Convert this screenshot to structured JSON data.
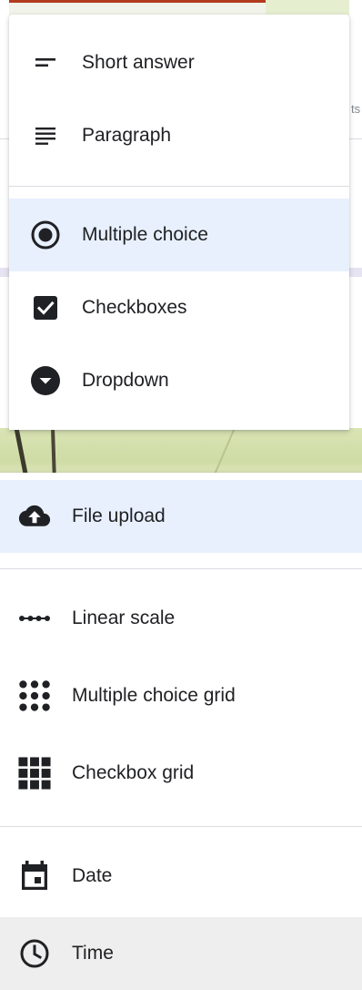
{
  "stray_text": "ts",
  "menu_top": {
    "items": [
      {
        "label": "Short answer",
        "icon": "short-answer-icon"
      },
      {
        "label": "Paragraph",
        "icon": "paragraph-icon"
      },
      {
        "label": "Multiple choice",
        "icon": "radio-button-icon",
        "selected": true
      },
      {
        "label": "Checkboxes",
        "icon": "checkbox-icon"
      },
      {
        "label": "Dropdown",
        "icon": "dropdown-icon"
      }
    ]
  },
  "menu_bottom": {
    "items": [
      {
        "label": "File upload",
        "icon": "cloud-upload-icon",
        "selected": true
      },
      {
        "label": "Linear scale",
        "icon": "linear-scale-icon"
      },
      {
        "label": "Multiple choice grid",
        "icon": "dot-grid-icon"
      },
      {
        "label": "Checkbox grid",
        "icon": "square-grid-icon"
      },
      {
        "label": "Date",
        "icon": "calendar-icon"
      },
      {
        "label": "Time",
        "icon": "clock-icon",
        "hovered": true
      }
    ]
  },
  "colors": {
    "icon": "#202124",
    "selected_bg": "#e8f0fe",
    "hover_bg": "#eeeeee",
    "divider": "#dadce0"
  }
}
